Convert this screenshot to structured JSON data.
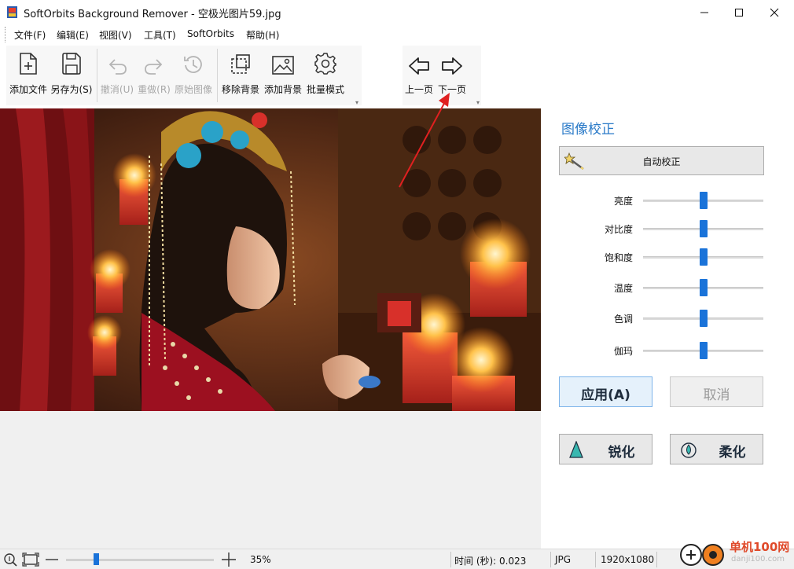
{
  "window": {
    "title": "SoftOrbits Background Remover - 空极光图片59.jpg"
  },
  "menu": {
    "items": [
      {
        "label": "文件(F)"
      },
      {
        "label": "编辑(E)"
      },
      {
        "label": "视图(V)"
      },
      {
        "label": "工具(T)"
      },
      {
        "label": "SoftOrbits"
      },
      {
        "label": "帮助(H)"
      }
    ]
  },
  "toolbar": {
    "add_file": "添加文件",
    "save_as": "另存为(S)",
    "undo": "撤消(U)",
    "redo": "重做(R)",
    "original": "原始图像",
    "remove_bg": "移除背景",
    "add_bg": "添加背景",
    "batch": "批量模式",
    "prev_page": "上一页",
    "next_page": "下一页"
  },
  "panel": {
    "title": "图像校正",
    "auto_correct": "自动校正",
    "sliders": [
      {
        "label": "亮度",
        "value": 0.5
      },
      {
        "label": "对比度",
        "value": 0.5
      },
      {
        "label": "饱和度",
        "value": 0.5
      },
      {
        "label": "温度",
        "value": 0.5
      },
      {
        "label": "色调",
        "value": 0.5
      },
      {
        "label": "伽玛",
        "value": 0.5
      }
    ],
    "apply": "应用(A)",
    "cancel": "取消",
    "sharpen": "锐化",
    "soften": "柔化"
  },
  "status": {
    "zoom": "35%",
    "zoom_level": 0.2,
    "time": "时间 (秒): 0.023",
    "format": "JPG",
    "dimensions": "1920x1080"
  },
  "watermark": {
    "text": "单机100网",
    "sub": "danji100.com"
  },
  "colors": {
    "accent": "#1a73d9",
    "panel_title": "#2a7ac8",
    "annotation_arrow": "#e02020"
  }
}
